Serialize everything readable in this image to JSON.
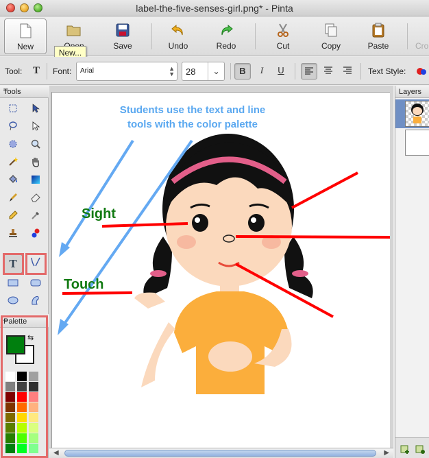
{
  "window": {
    "title": "label-the-five-senses-girl.png* - Pinta"
  },
  "toolbar": {
    "buttons": [
      {
        "label": "New",
        "icon": "new-document-icon"
      },
      {
        "label": "Open",
        "icon": "folder-open-icon"
      },
      {
        "label": "Save",
        "icon": "floppy-disk-icon"
      },
      {
        "label": "Undo",
        "icon": "undo-arrow-icon"
      },
      {
        "label": "Redo",
        "icon": "redo-arrow-icon"
      },
      {
        "label": "Cut",
        "icon": "scissors-icon"
      },
      {
        "label": "Copy",
        "icon": "copy-icon"
      },
      {
        "label": "Paste",
        "icon": "clipboard-icon"
      },
      {
        "label": "Cro",
        "icon": "crop-icon"
      }
    ],
    "tooltip": "New..."
  },
  "options": {
    "tool_label": "Tool:",
    "font_label": "Font:",
    "font_value": "Arial",
    "size_value": "28",
    "bold": "B",
    "italic": "I",
    "underline": "U",
    "text_style_label": "Text Style:"
  },
  "tools_pad": {
    "title": "Tools",
    "minimize": "–"
  },
  "palette_pad": {
    "title": "Palette",
    "minimize": "–",
    "primary_color": "#007f0e",
    "secondary_color": "#ffffff",
    "colors": [
      [
        "#ffffff",
        "#000000",
        "#a0a0a0"
      ],
      [
        "#808080",
        "#404040",
        "#303030"
      ],
      [
        "#7f0000",
        "#ff0000",
        "#ff7f7f"
      ],
      [
        "#7f3300",
        "#ff6a00",
        "#ffb27f"
      ],
      [
        "#7f6a00",
        "#ffd800",
        "#ffe97f"
      ],
      [
        "#5b7f00",
        "#b6ff00",
        "#daff7f"
      ],
      [
        "#267f00",
        "#4cff00",
        "#a5ff7f"
      ],
      [
        "#007f0e",
        "#00ff21",
        "#7fff8e"
      ]
    ]
  },
  "layers_pad": {
    "title": "Layers"
  },
  "canvas": {
    "instruction": [
      "Students use the text and line",
      "tools with the color palette"
    ],
    "label_sight": "Sight",
    "label_touch": "Touch",
    "instruction_color": "#5aa8f0",
    "label_color": "#127a12",
    "line_color": "#ff0000"
  }
}
